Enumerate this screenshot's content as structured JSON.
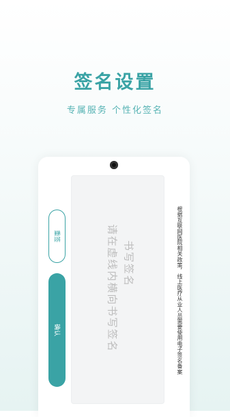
{
  "header": {
    "title": "签名设置",
    "subtitle": "专属服务 个性化签名"
  },
  "signature_pad": {
    "title": "书写签名",
    "hint": "请在虚线内横向书写签名"
  },
  "notice": {
    "text": "根据互联网医院相关政策，线上医疗从业人员需要使用电子签名备案"
  },
  "buttons": {
    "reset_label": "重签",
    "confirm_label": "确认"
  },
  "colors": {
    "accent": "#3aa3a5",
    "placeholder": "#bdbdbd"
  },
  "icons": {
    "camera": "camera-dot-icon"
  }
}
